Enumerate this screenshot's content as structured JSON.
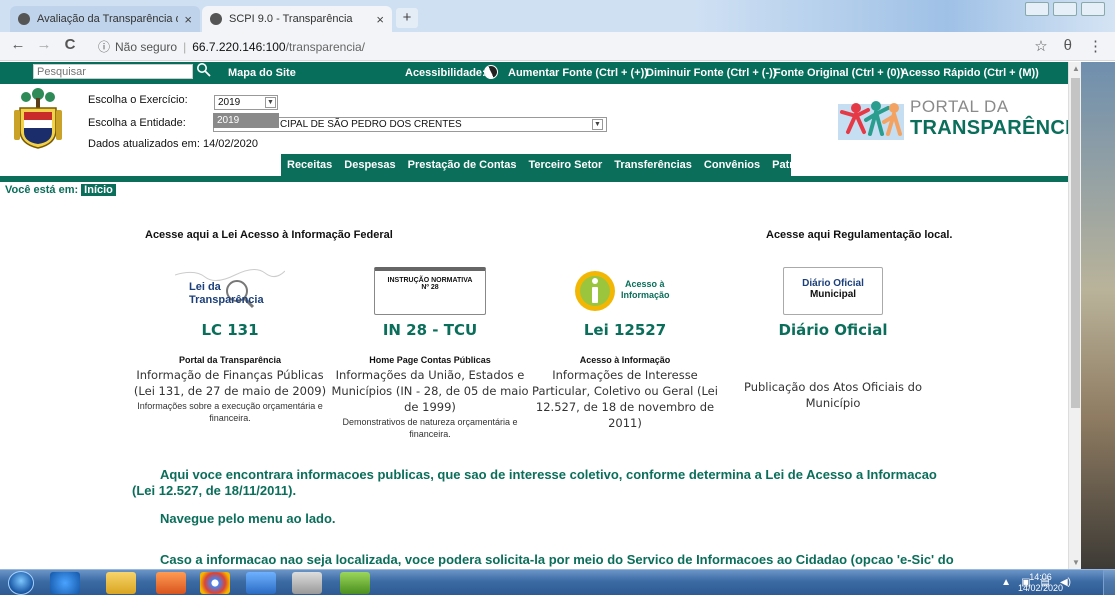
{
  "browser": {
    "tabs": [
      {
        "title": "Avaliação da Transparência dos M",
        "close": "×"
      },
      {
        "title": "SCPI 9.0 - Transparência",
        "close": "×"
      }
    ],
    "newtab": "+",
    "back": "←",
    "forward": "→",
    "reload": "C",
    "not_secure": "Não seguro",
    "url_host": "66.7.220.146:100",
    "url_path": "/transparencia/",
    "star": "☆",
    "profile": "θ",
    "menu": "⋮"
  },
  "topbar": {
    "search_placeholder": "Pesquisar",
    "site_map": "Mapa do Site",
    "accessibility": "Acessibilidade:",
    "increase_font": "Aumentar Fonte (Ctrl + (+))",
    "decrease_font": "Diminuir Fonte (Ctrl + (-))",
    "original_font": "Fonte Original (Ctrl + (0))",
    "quick_access": "Acesso Rápido (Ctrl + (M))"
  },
  "header": {
    "year_label": "Escolha o Exercício:",
    "year_value": "2019",
    "year_option": "2019",
    "entity_label": "Escolha a Entidade:",
    "entity_value": "CIPAL DE SÃO PEDRO DOS CRENTES",
    "updated": "Dados atualizados em: 14/02/2020",
    "portal_top": "PORTAL DA",
    "portal_bottom": "TRANSPARÊNCIA"
  },
  "menu": [
    "Receitas",
    "Despesas",
    "Prestação de Contas",
    "Terceiro Setor",
    "Transferências",
    "Convênios",
    "Patrimônio"
  ],
  "breadcrumb": {
    "label": "Você está em:",
    "link": "Início"
  },
  "sections": {
    "federal": "Acesse aqui a Lei Acesso à Informação Federal",
    "local": "Acesse aqui Regulamentação local."
  },
  "cards": [
    {
      "logo_line1": "Lei da",
      "logo_line2": "Transparência",
      "code": "LC 131",
      "small_title": "Portal da Transparência",
      "desc": "Informação de Finanças Públicas (Lei 131, de 27 de maio de 2009)",
      "extra": "Informações sobre a execução orçamentária e financeira."
    },
    {
      "logo_line1": "INSTRUÇÃO NORMATIVA",
      "logo_line2": "Nº 28",
      "code": "IN 28 - TCU",
      "small_title": "Home Page Contas Públicas",
      "desc": "Informações da União, Estados e Municípios (IN - 28, de 05 de maio de 1999)",
      "extra": "Demonstrativos de natureza orçamentária e financeira."
    },
    {
      "logo_line1": "Acesso à",
      "logo_line2": "Informação",
      "code": "Lei 12527",
      "small_title": "Acesso à Informação",
      "desc": "Informações de Interesse Particular, Coletivo ou Geral (Lei 12.527, de 18 de novembro de 2011)",
      "extra": ""
    },
    {
      "logo_line1": "Diário Oficial",
      "logo_line2": "Municipal",
      "code": "Diário Oficial",
      "small_title": "",
      "desc": "Publicação dos Atos Oficiais do Município",
      "extra": ""
    }
  ],
  "paragraphs": {
    "p1": "Aqui voce encontrara informacoes publicas, que sao de interesse coletivo, conforme determina a Lei de Acesso a Informacao (Lei 12.527, de 18/11/2011).",
    "p2": "Navegue pelo menu ao lado.",
    "p3": "Caso a informacao nao seja localizada, voce podera solicita-la por meio do Servico de Informacoes ao Cidadao (opcao 'e-Sic' do"
  },
  "taskbar": {
    "time": "14:06",
    "date": "14/02/2020"
  },
  "colors": {
    "brand_green": "#0a6e5a",
    "taskbar_blue": "#3c6aa3"
  }
}
